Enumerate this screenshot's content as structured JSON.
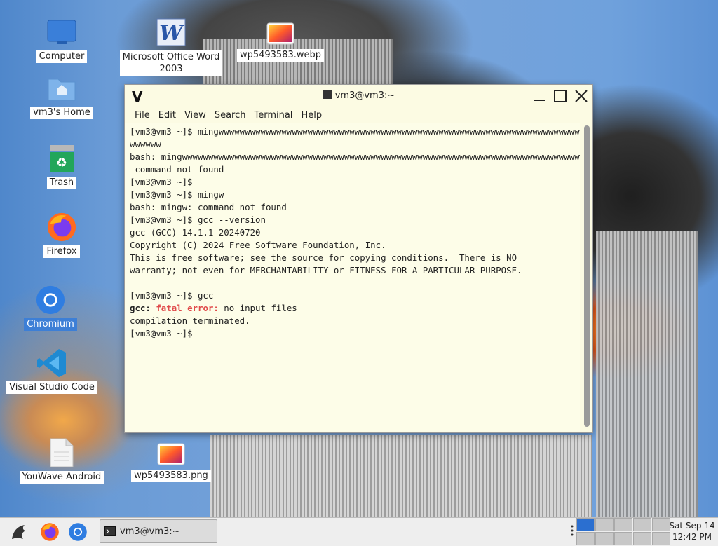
{
  "desktop": {
    "icons": [
      {
        "label": "Computer"
      },
      {
        "label": "vm3's Home"
      },
      {
        "label": "Trash"
      },
      {
        "label": "Firefox"
      },
      {
        "label": "Chromium"
      },
      {
        "label": "Visual Studio Code"
      },
      {
        "label": "YouWave Android"
      },
      {
        "label": "Microsoft Office Word\n2003"
      },
      {
        "label": "wp5493583.webp"
      },
      {
        "label": "wp5493583.png"
      }
    ],
    "selected_icon": "Chromium"
  },
  "terminal": {
    "title": "vm3@vm3:~",
    "menu": [
      "File",
      "Edit",
      "View",
      "Search",
      "Terminal",
      "Help"
    ],
    "lines": {
      "l1": "[vm3@vm3 ~]$ mingwwwwwwwwwwwwwwwwwwwwwwwwwwwwwwwwwwwwwwwwwwwwwwwwwwwwwwwwwwwwwwwwwwwwwwwwwwwwwwwwwwwwwwwwwwwwww",
      "l2": "wwwwww",
      "l3": "bash: mingwwwwwwwwwwwwwwwwwwwwwwwwwwwwwwwwwwwwwwwwwwwwwwwwwwwwwwwwwwwwwwwwwwwwwwwwwwwwwwwwwwwwwwwwwwwwwwww:",
      "l4": " command not found",
      "l5": "[vm3@vm3 ~]$",
      "l6": "[vm3@vm3 ~]$ mingw",
      "l7": "bash: mingw: command not found",
      "l8": "[vm3@vm3 ~]$ gcc --version",
      "l9": "gcc (GCC) 14.1.1 20240720",
      "l10": "Copyright (C) 2024 Free Software Foundation, Inc.",
      "l11": "This is free software; see the source for copying conditions.  There is NO",
      "l12": "warranty; not even for MERCHANTABILITY or FITNESS FOR A PARTICULAR PURPOSE.",
      "l13": "",
      "l14": "[vm3@vm3 ~]$ gcc",
      "l15a": "gcc:",
      "l15b": "fatal error:",
      "l15c": " no input files",
      "l16": "compilation terminated.",
      "l17": "[vm3@vm3 ~]$"
    }
  },
  "taskbar": {
    "task_label": "vm3@vm3:~",
    "clock_date": "Sat Sep 14",
    "clock_time": "12:42 PM",
    "workspaces": 10,
    "active_workspace": 1
  },
  "colors": {
    "terminal_bg": "#fcfbe3",
    "error_red": "#e04a4a",
    "selection_blue": "#3d7fd6"
  }
}
